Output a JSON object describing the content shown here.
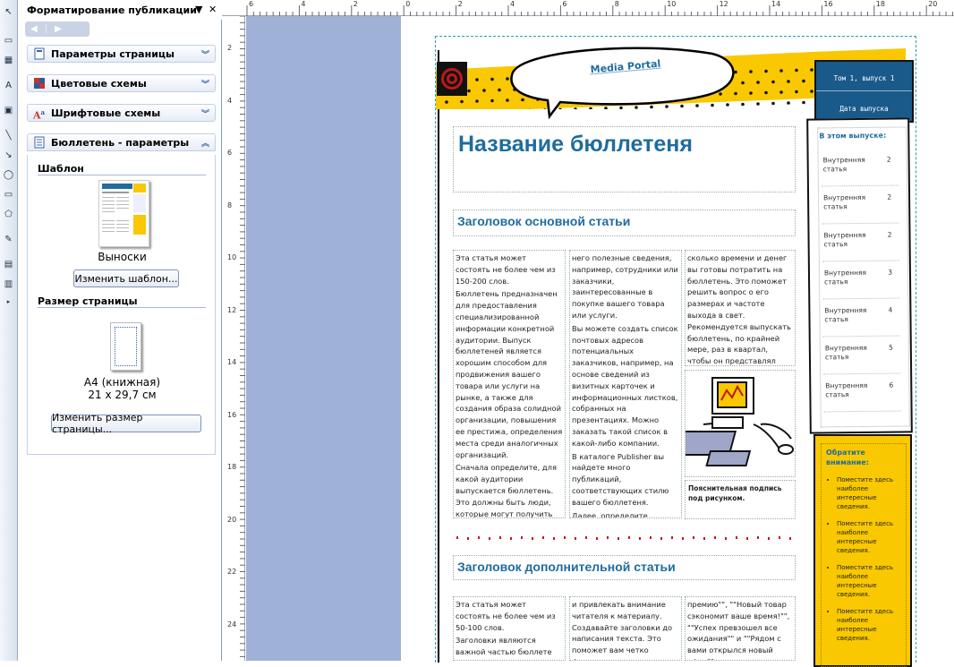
{
  "task_pane": {
    "title": "Форматирование публикации",
    "sections": [
      {
        "label": "Параметры страницы"
      },
      {
        "label": "Цветовые схемы"
      },
      {
        "label": "Шрифтовые схемы"
      },
      {
        "label": "Бюллетень - параметры"
      }
    ],
    "template_heading": "Шаблон",
    "template_name": "Выноски",
    "change_template_button": "Изменить шаблон...",
    "page_size_heading": "Размер страницы",
    "page_size_name": "A4 (книжная)",
    "page_size_dims": "21 x 29,7 см",
    "change_size_button": "Изменить размер страницы..."
  },
  "ruler": {
    "horizontal": [
      "6",
      "4",
      "2",
      "0",
      "2",
      "4",
      "6",
      "8",
      "10",
      "12",
      "14",
      "16",
      "18",
      "20"
    ],
    "vertical": [
      "2",
      "4",
      "6",
      "8",
      "10",
      "12",
      "14",
      "16",
      "18",
      "20",
      "22",
      "24"
    ]
  },
  "newsletter": {
    "logo_text": "Media Portal",
    "issue": "Том 1, выпуск 1",
    "date": "Дата выпуска",
    "title": "Название бюллетеня",
    "main_heading": "Заголовок основной статьи",
    "col1": [
      "Эта статья может состоять не более чем из 150-200 слов.",
      "Бюллетень предназначен для предоставления специализированной информации конкретной аудитории. Выпуск бюллетеней является хорошим способом для продвижения вашего товара или услуги на рынке, а также для создания образа солидной организации, повышения ее престижа, определения места среди аналогичных организаций.",
      "Сначала определите, для какой аудитории выпускается бюллетень. Это должны быть люди, которые могут получить из"
    ],
    "col2": [
      "него полезные сведения, например, сотрудники или заказчики, заинтересованные в покупке вашего товара или услуги.",
      "Вы можете создать список почтовых адресов потенциальных заказчиков, например, на основе сведений из визитных карточек и информационных листков, собранных на презентациях. Можно заказать такой список в какой-либо компании.",
      "В каталоге Publisher вы найдете много публикаций, соответствующих стилю вашего бюллетеня.",
      "Далее, определите"
    ],
    "col3": "сколько времени и денег вы готовы потратить на бюллетень. Это поможет решить вопрос о его размерах и частоте выхода в свет. Рекомендуется выпускать бюллетень, по крайней мере, раз в квартал, чтобы он представлял собой",
    "caption": "Пояснительная подпись под рисунком.",
    "toc_title": "В этом выпуске:",
    "toc": [
      {
        "t": "Внутренняя статья",
        "n": "2"
      },
      {
        "t": "Внутренняя статья",
        "n": "2"
      },
      {
        "t": "Внутренняя статья",
        "n": "2"
      },
      {
        "t": "Внутренняя статья",
        "n": "3"
      },
      {
        "t": "Внутренняя статья",
        "n": "4"
      },
      {
        "t": "Внутренняя статья",
        "n": "5"
      },
      {
        "t": "Внутренняя статья",
        "n": "6"
      }
    ],
    "note_title": "Обратите внимание:",
    "note_items": [
      "Поместите здесь наиболее интересные сведения.",
      "Поместите здесь наиболее интересные сведения.",
      "Поместите здесь наиболее интересные сведения.",
      "Поместите здесь наиболее интересные сведения."
    ],
    "second_heading": "Заголовок дополнительной статьи",
    "s_col1": [
      "Эта статья может состоять не более чем из 50-100 слов.",
      "Заголовки являются важной частью бюллете"
    ],
    "s_col2": "и привлекать внимание читателя к материалу. Создавайте заголовки до написания текста. Это поможет вам четко формулировать свои",
    "s_col3": "премию\"\", \"\"Новый товар сэкономит ваше время!\"\", \"\"Успех превзошел все ожидания\"\" и \"\"Рядом с вами открылся новый офис\"\"",
    "colors": {
      "accent": "#1f6c9e",
      "yellow": "#f9c800",
      "pane_blue": "#1a5a8a"
    }
  }
}
